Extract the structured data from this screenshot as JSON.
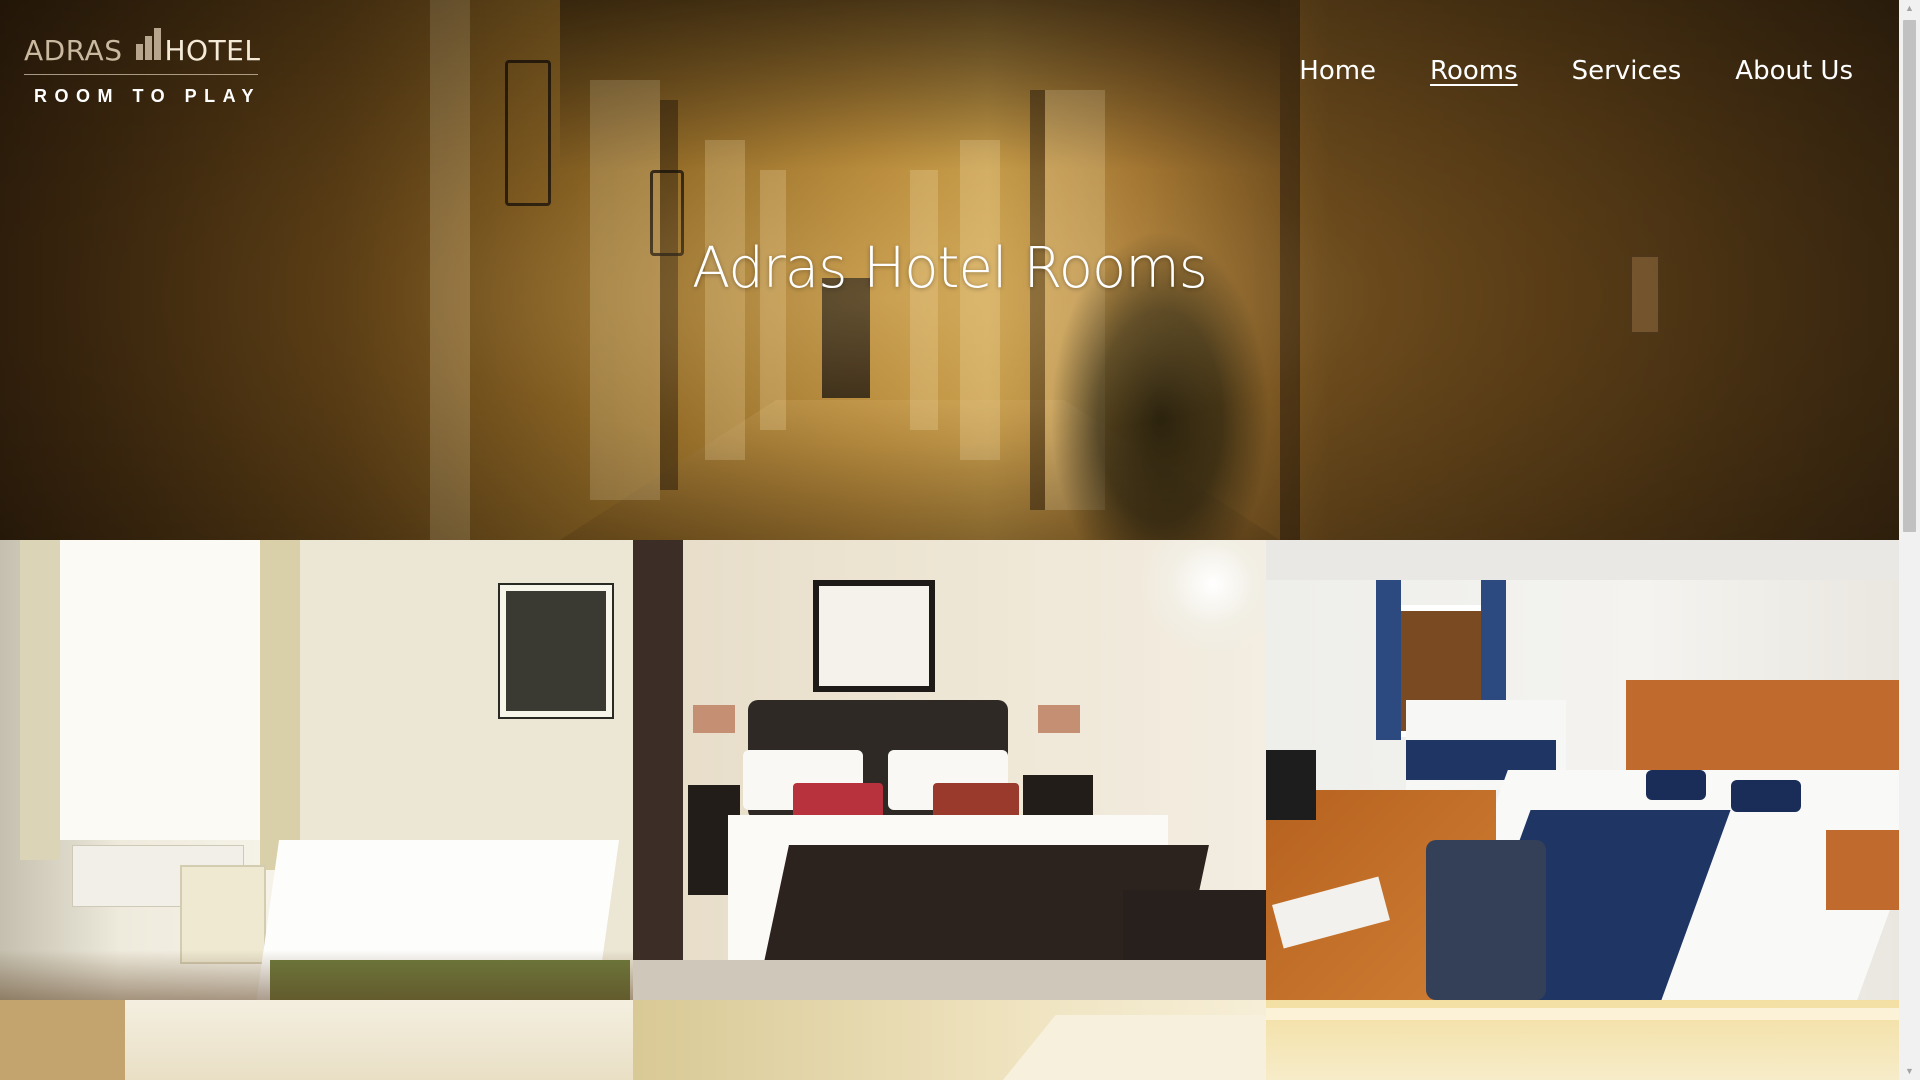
{
  "brand": {
    "name_part1": "ADRAS",
    "name_part2": "HOTEL",
    "tagline": "ROOM TO PLAY"
  },
  "nav": {
    "items": [
      {
        "label": "Home",
        "active": false
      },
      {
        "label": "Rooms",
        "active": true
      },
      {
        "label": "Services",
        "active": false
      },
      {
        "label": "About Us",
        "active": false
      }
    ]
  },
  "hero": {
    "title": "Adras Hotel Rooms"
  },
  "colors": {
    "nav_text": "#ffffff",
    "brand_accent": "#c9b9a0"
  }
}
